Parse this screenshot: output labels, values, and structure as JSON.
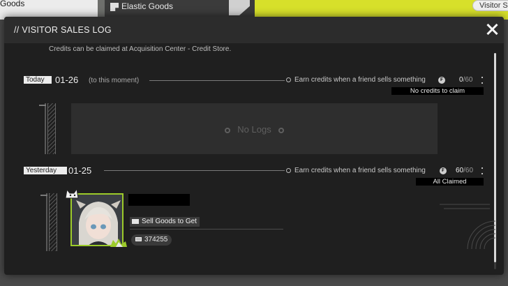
{
  "background": {
    "left_label": "Goods",
    "panel_label": "Elastic Goods",
    "visitor_button": "Visitor Sales"
  },
  "modal": {
    "title": "// VISITOR SALES LOG",
    "note": "Credits can be claimed at Acquisition Center - Credit Store."
  },
  "days": [
    {
      "label": "Today",
      "date": "01-26",
      "subtitle": "(to this moment)",
      "earn_text": "Earn credits when a friend sells something",
      "count": "0",
      "total": "/60",
      "status": "No credits to claim",
      "empty_text": "No Logs"
    },
    {
      "label": "Yesterday",
      "date": "01-25",
      "earn_text": "Earn credits when a friend sells something",
      "count": "60",
      "total": "/60",
      "status": "All Claimed",
      "entry": {
        "action": "Sell Goods to Get",
        "credits": "374255"
      }
    }
  ],
  "colors": {
    "accent_green": "#9ccb2a",
    "background_yellow": "#d7e02a"
  }
}
